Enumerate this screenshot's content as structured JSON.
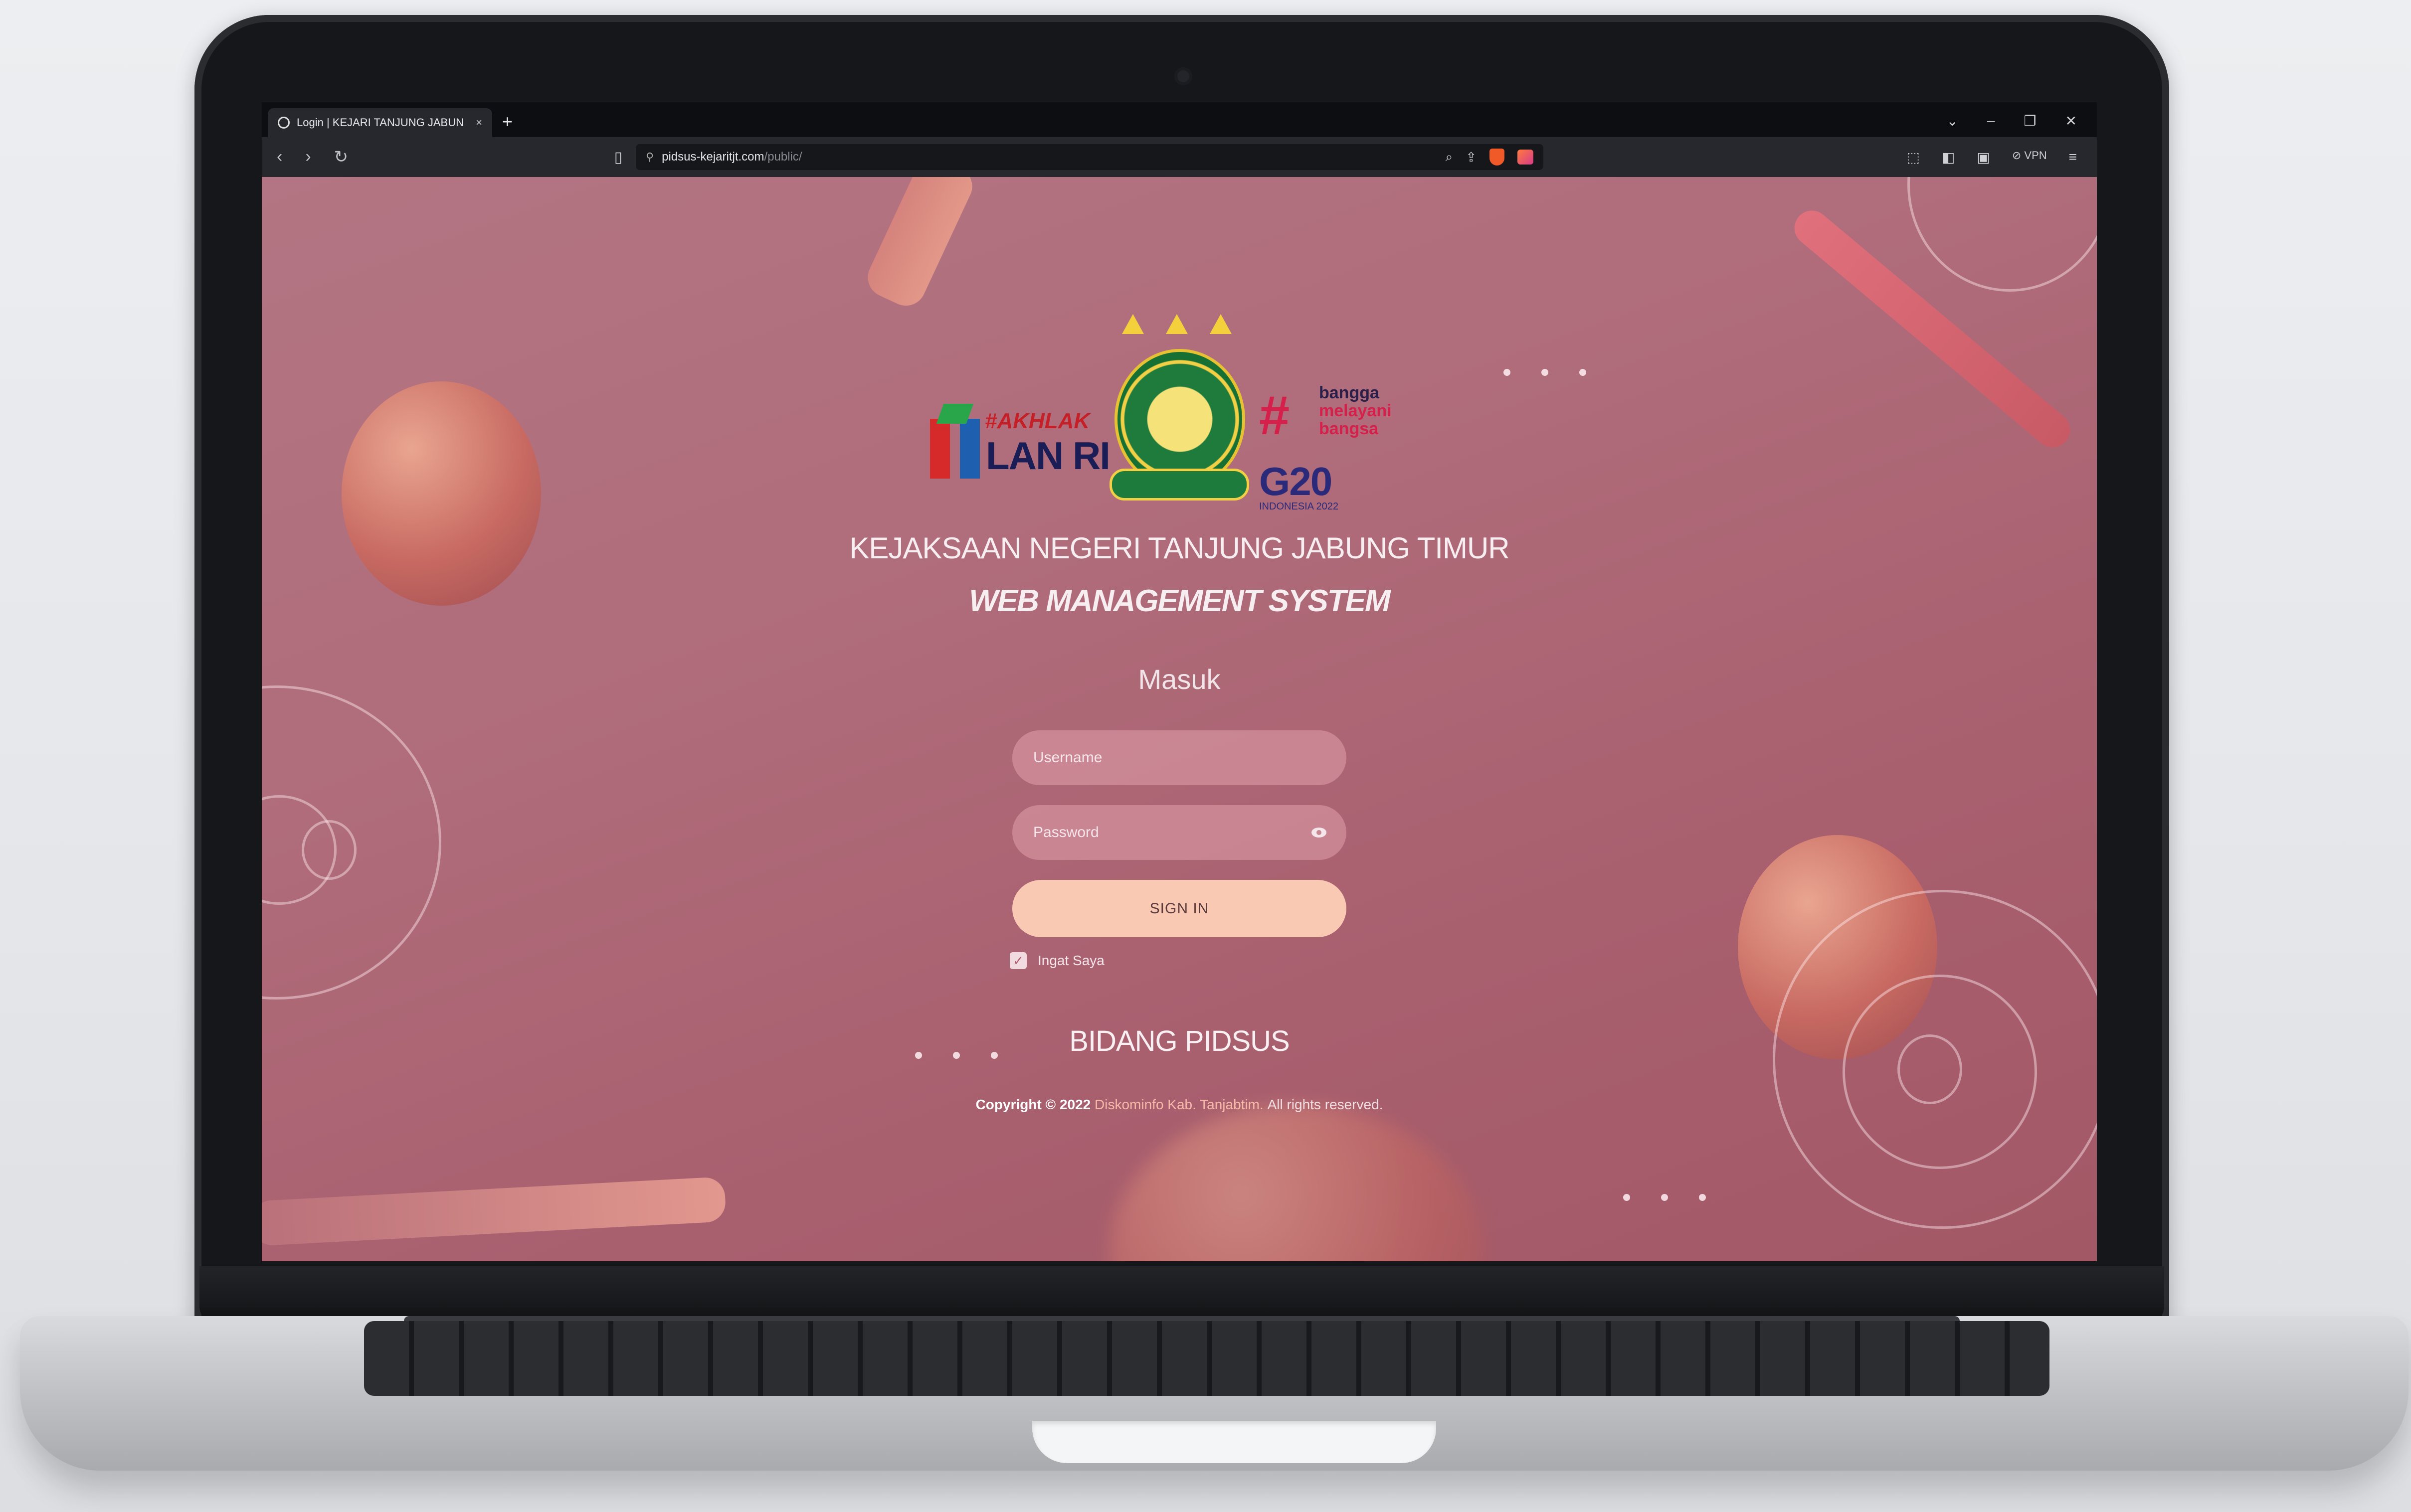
{
  "browser": {
    "tab_title": "Login | KEJARI TANJUNG JABUN",
    "tab_close": "×",
    "new_tab": "+",
    "url_host": "pidsus-kejaritjt.com",
    "url_path": "/public/",
    "vpn_label": "VPN",
    "window_controls": [
      "⌄",
      "–",
      "❐",
      "✕"
    ]
  },
  "logos": {
    "lan_text": "LAN RI",
    "akhlak_text": "#AKHLAK",
    "g20_hash": "#",
    "g20_bangga_1": "bangga",
    "g20_bangga_2": "melayani",
    "g20_bangga_3": "bangsa",
    "g20_text": "G20",
    "g20_sub": "INDONESIA 2022"
  },
  "header": {
    "org_title": "KEJAKSAAN NEGERI TANJUNG JABUNG TIMUR",
    "app_title": "WEB MANAGEMENT SYSTEM"
  },
  "form": {
    "heading": "Masuk",
    "username_placeholder": "Username",
    "password_placeholder": "Password",
    "submit_label": "SIGN IN",
    "remember_label": "Ingat Saya",
    "remember_checked": true
  },
  "footer": {
    "department": "BIDANG PIDSUS",
    "copyright_prefix": "Copyright © 2022",
    "copyright_link": "Diskominfo Kab. Tanjabtim.",
    "copyright_suffix": "All rights reserved."
  },
  "colors": {
    "page_bg": "#ad6674",
    "button_bg": "#f9c9b4",
    "field_bg": "#e2a0ac"
  }
}
